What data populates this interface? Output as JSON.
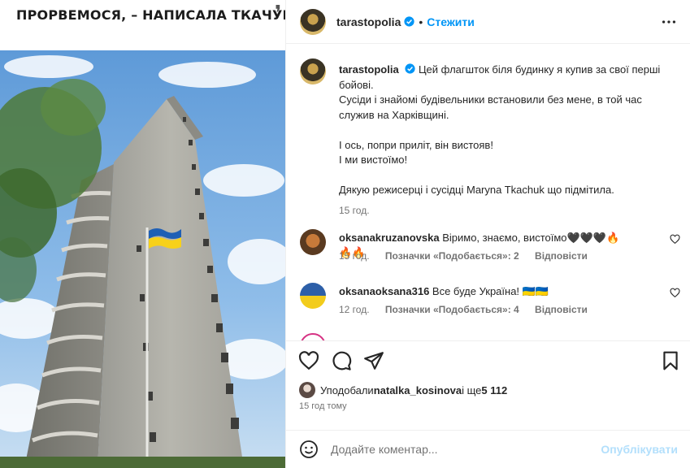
{
  "photo": {
    "headline": "ПРОРВЕМОСЯ, – НАПИСАЛА ТКАЧУК.",
    "quote_mark": "❜"
  },
  "post": {
    "username": "tarastopolia",
    "dot": "•",
    "follow_label": "Стежити",
    "caption": {
      "username": "tarastopolia",
      "line1": "Цей флагшток біля будинку я купив за свої перші бойові.",
      "line2": "Сусіди і знайомі будівельники встановили без мене, в той час служив на Харківщині.",
      "line3": "І ось, попри приліт, він вистояв!",
      "line4": "І ми вистоїмо!",
      "line5": "Дякую режисерці і сусідці Maryna Tkachuk що підмітила.",
      "time": "15 год."
    },
    "comments": [
      {
        "username": "oksanakruzanovska",
        "text": "Віримо, знаємо, вистоїмо🖤🖤🖤🔥🔥🔥",
        "time": "15 год.",
        "likes": "Позначки «Подобається»: 2",
        "reply": "Відповісти",
        "avatar_color": "#8a5a2b"
      },
      {
        "username": "oksanaoksana316",
        "text": "Все буде Україна! 🇺🇦🇺🇦",
        "time": "12 год.",
        "likes": "Позначки «Подобається»: 4",
        "reply": "Відповісти",
        "avatar_color": "#2d5fa8"
      }
    ],
    "liked_by_prefix": "Уподобали ",
    "liked_by_user": "natalka_kosinova",
    "liked_by_suffix": " і ще ",
    "liked_by_count": "5 112",
    "time_ago": "15 год тому",
    "comment_placeholder": "Додайте коментар...",
    "publish_label": "Опублікувати"
  },
  "colors": {
    "accent": "#0095f6",
    "publish_disabled": "#b2dffc",
    "meta_text": "#737373",
    "border": "#efefef",
    "flag_blue": "#1f5fb5",
    "flag_yellow": "#f7d11a"
  },
  "icons": [
    "verified-icon",
    "more-options-icon",
    "heart-icon",
    "comment-icon",
    "share-icon",
    "bookmark-icon",
    "emoji-icon"
  ]
}
